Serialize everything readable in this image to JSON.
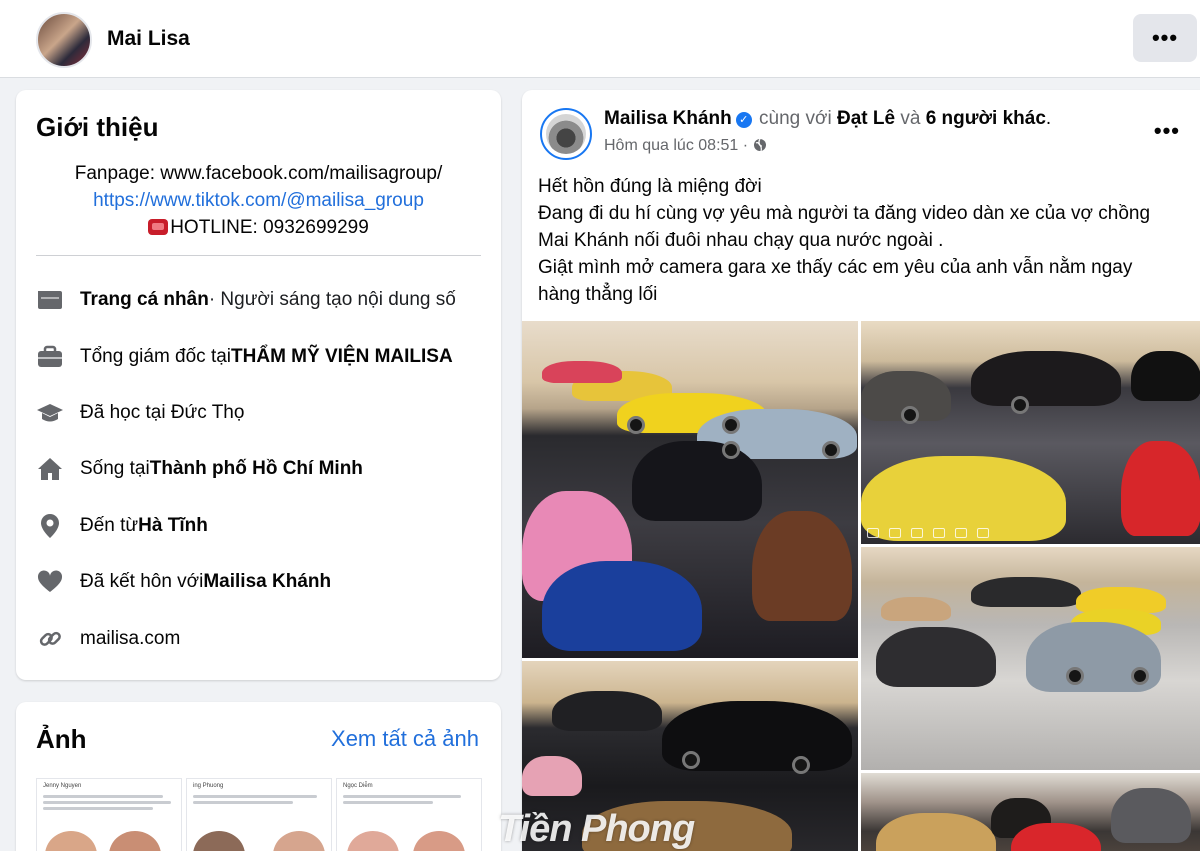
{
  "header": {
    "profile_name": "Mai Lisa",
    "more_label": "•••"
  },
  "intro": {
    "title": "Giới thiệu",
    "bio": {
      "fanpage_prefix": "Fanpage: ",
      "fanpage_url": "www.facebook.com/mailisagroup/",
      "tiktok_url": "https://www.tiktok.com/@mailisa_group",
      "hotline": "HOTLINE: 0932699299"
    },
    "items": [
      {
        "icon": "profile-icon",
        "bold": "Trang cá nhân",
        "text": " · Người sáng tạo nội dung số"
      },
      {
        "icon": "briefcase-icon",
        "text": "Tổng giám đốc tại ",
        "bold": "THẨM MỸ VIỆN MAILISA"
      },
      {
        "icon": "graduation-cap-icon",
        "text": "Đã học tại Đức Thọ"
      },
      {
        "icon": "home-icon",
        "text": "Sống tại ",
        "bold": "Thành phố Hồ Chí Minh"
      },
      {
        "icon": "location-pin-icon",
        "text": "Đến từ ",
        "bold": "Hà Tĩnh"
      },
      {
        "icon": "heart-icon",
        "text": "Đã kết hôn với ",
        "bold": "Mailisa Khánh"
      },
      {
        "icon": "link-icon",
        "text": "mailisa.com"
      }
    ]
  },
  "photos": {
    "title": "Ảnh",
    "see_all": "Xem tất cả ảnh",
    "thumbnails": [
      "Jenny Nguyen",
      "ing Phuong",
      "Ngọc Diễm"
    ]
  },
  "post": {
    "author": "Mailisa Khánh",
    "with_text": "cùng với",
    "tagged": "Đạt Lê",
    "and_text": "và",
    "others": "6 người khác",
    "timestamp": "Hôm qua lúc 08:51 ·",
    "more_label": "•••",
    "text_lines": [
      "Hết hồn đúng là miệng đời",
      "Đang đi du hí cùng vợ yêu mà người ta đăng video dàn xe của vợ chồng Mai Khánh nối đuôi nhau chạy qua nước ngoài .",
      "Giật mình mở camera gara xe thấy các em yêu của anh vẫn nằm ngay hàng thẳng lối"
    ],
    "watermark": "Tiền Phong"
  },
  "colors": {
    "link": "#216fdb",
    "verified": "#1877f2",
    "background": "#f0f2f5"
  }
}
